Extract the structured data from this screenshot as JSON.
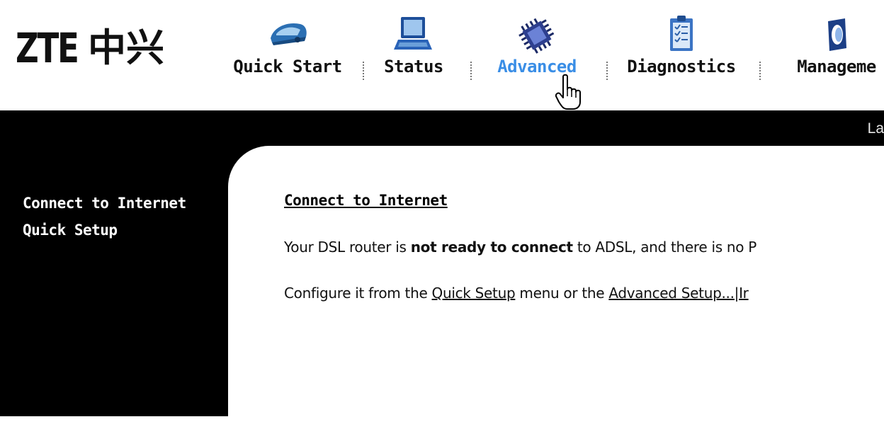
{
  "brand": {
    "latin": "ZTE",
    "chinese": "中兴"
  },
  "nav": {
    "items": [
      {
        "label": "Quick Start",
        "icon": "car-icon"
      },
      {
        "label": "Status",
        "icon": "laptop-icon"
      },
      {
        "label": "Advanced",
        "icon": "chip-icon",
        "active": true
      },
      {
        "label": "Diagnostics",
        "icon": "clipboard-icon"
      },
      {
        "label": "Manageme",
        "icon": "management-icon"
      }
    ]
  },
  "band": {
    "language_link": "La"
  },
  "sidebar": {
    "items": [
      {
        "label": "Connect to Internet"
      },
      {
        "label": "Quick Setup"
      }
    ]
  },
  "content": {
    "title": "Connect to Internet",
    "line1": {
      "prefix": "Your DSL router is ",
      "bold": "not ready to connect",
      "suffix": " to ADSL, and there is no P"
    },
    "line2": {
      "prefix": "Configure it from the ",
      "link1": "Quick Setup",
      "middle": " menu or the ",
      "link2": "Advanced Setup...|Ir"
    }
  },
  "colors": {
    "active_nav": "#3a8ee6",
    "band": "#000000",
    "panel": "#ffffff"
  }
}
